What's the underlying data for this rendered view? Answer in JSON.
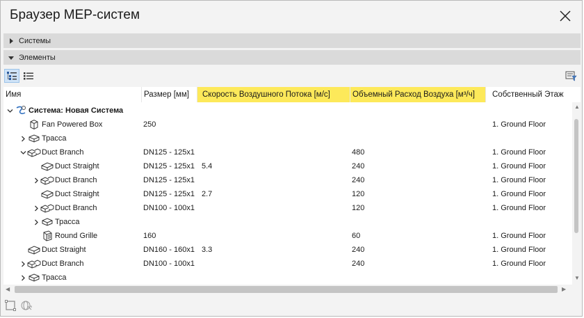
{
  "window": {
    "title": "Браузер MEP-систем"
  },
  "panels": {
    "systems_label": "Системы",
    "elements_label": "Элементы"
  },
  "columns": [
    {
      "label": "Имя",
      "highlight": false
    },
    {
      "label": "Размер [мм]",
      "highlight": false
    },
    {
      "label": "Скорость Воздушного Потока [м/с]",
      "highlight": true
    },
    {
      "label": "Объемный Расход Воздуха [м³/ч]",
      "highlight": true
    },
    {
      "label": "Собственный Этаж",
      "highlight": false
    }
  ],
  "rows": [
    {
      "depth": 0,
      "expander": "open",
      "icon": "system-icon",
      "name": "Система: Новая Система",
      "bold": true,
      "size": "",
      "velocity": "",
      "flow": "",
      "floor": ""
    },
    {
      "depth": 1,
      "expander": "none",
      "icon": "fan-box-icon",
      "name": "Fan Powered Box",
      "size": "250",
      "velocity": "",
      "flow": "",
      "floor": "1. Ground Floor"
    },
    {
      "depth": 1,
      "expander": "closed",
      "icon": "route-icon",
      "name": "Трасса",
      "size": "",
      "velocity": "",
      "flow": "",
      "floor": ""
    },
    {
      "depth": 1,
      "expander": "open",
      "icon": "duct-branch-icon",
      "name": "Duct Branch",
      "size": "DN125 - 125x1",
      "velocity": "",
      "flow": "480",
      "floor": "1. Ground Floor"
    },
    {
      "depth": 2,
      "expander": "none",
      "icon": "duct-straight-icon",
      "name": "Duct Straight",
      "size": "DN125 - 125x1",
      "velocity": "5.4",
      "flow": "240",
      "floor": "1. Ground Floor"
    },
    {
      "depth": 2,
      "expander": "closed",
      "icon": "duct-branch-icon",
      "name": "Duct Branch",
      "size": "DN125 - 125x1",
      "velocity": "",
      "flow": "240",
      "floor": "1. Ground Floor"
    },
    {
      "depth": 2,
      "expander": "none",
      "icon": "duct-straight-icon",
      "name": "Duct Straight",
      "size": "DN125 - 125x1",
      "velocity": "2.7",
      "flow": "120",
      "floor": "1. Ground Floor"
    },
    {
      "depth": 2,
      "expander": "closed",
      "icon": "duct-branch-icon",
      "name": "Duct Branch",
      "size": "DN100 - 100x1",
      "velocity": "",
      "flow": "120",
      "floor": "1. Ground Floor"
    },
    {
      "depth": 2,
      "expander": "closed",
      "icon": "route-icon",
      "name": "Трасса",
      "size": "",
      "velocity": "",
      "flow": "",
      "floor": ""
    },
    {
      "depth": 2,
      "expander": "none",
      "icon": "round-grille-icon",
      "name": "Round Grille",
      "size": "160",
      "velocity": "",
      "flow": "60",
      "floor": "1. Ground Floor"
    },
    {
      "depth": 1,
      "expander": "none",
      "icon": "duct-straight-icon",
      "name": "Duct Straight",
      "size": "DN160 - 160x1",
      "velocity": "3.3",
      "flow": "240",
      "floor": "1. Ground Floor"
    },
    {
      "depth": 1,
      "expander": "closed",
      "icon": "duct-branch-icon",
      "name": "Duct Branch",
      "size": "DN100 - 100x1",
      "velocity": "",
      "flow": "240",
      "floor": "1. Ground Floor"
    },
    {
      "depth": 1,
      "expander": "closed",
      "icon": "route-icon",
      "name": "Трасса",
      "size": "",
      "velocity": "",
      "flow": "",
      "floor": ""
    }
  ],
  "colors": {
    "highlight": "#fde95a",
    "panel": "#dadada",
    "active_btn": "#cfe3f7"
  }
}
